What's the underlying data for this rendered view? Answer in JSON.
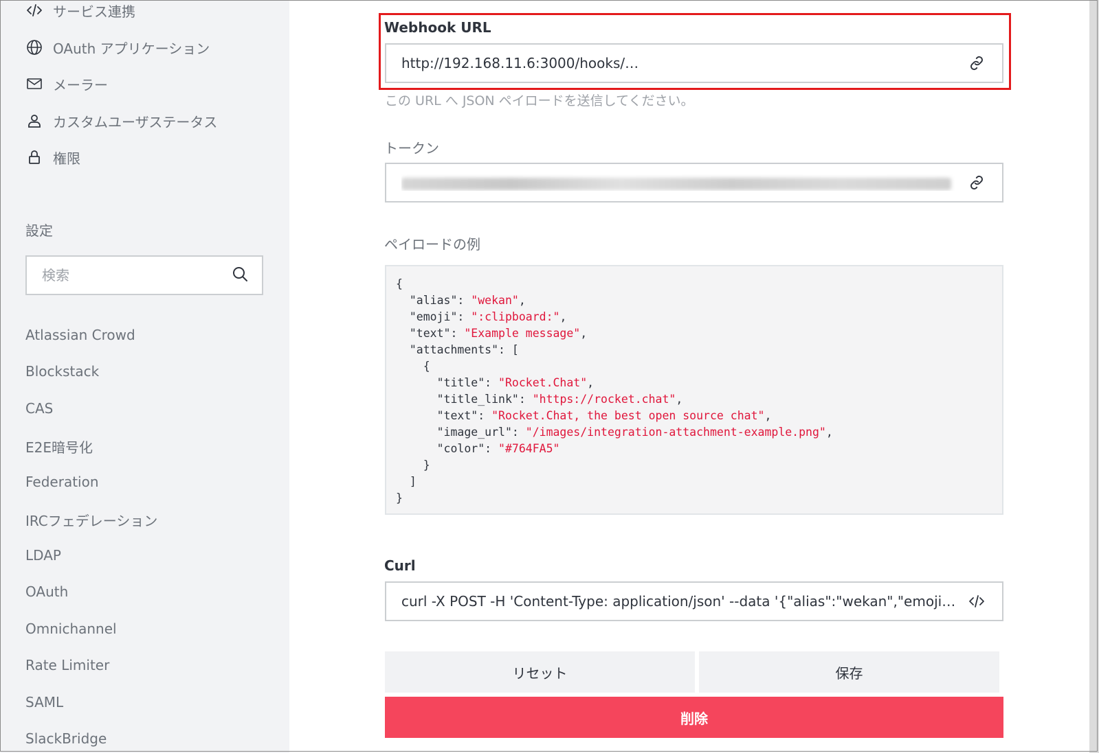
{
  "sidebar": {
    "nav_items": [
      {
        "label": "サービス連携",
        "icon": "code-icon"
      },
      {
        "label": "OAuth アプリケーション",
        "icon": "globe-icon"
      },
      {
        "label": "メーラー",
        "icon": "mail-icon"
      },
      {
        "label": "カスタムユーザステータス",
        "icon": "user-icon"
      },
      {
        "label": "権限",
        "icon": "lock-icon"
      }
    ],
    "settings_title": "設定",
    "search_placeholder": "検索",
    "settings_items": [
      "Atlassian Crowd",
      "Blockstack",
      "CAS",
      "E2E暗号化",
      "Federation",
      "IRCフェデレーション",
      "LDAP",
      "OAuth",
      "Omnichannel",
      "Rate Limiter",
      "SAML",
      "SlackBridge"
    ]
  },
  "main": {
    "webhook": {
      "label": "Webhook URL",
      "value_prefix": "http://192.168.11.6:3000/hooks/",
      "help": "この URL へ JSON ペイロードを送信してください。",
      "icon": "link-icon"
    },
    "token": {
      "label": "トークン",
      "icon": "link-icon"
    },
    "payload": {
      "label": "ペイロードの例"
    },
    "curl": {
      "label": "Curl",
      "value": "curl -X POST -H 'Content-Type: application/json' --data '{\"alias\":\"wekan\",\"emoji\":\":clipb...",
      "icon": "code-icon"
    },
    "buttons": {
      "reset": "リセット",
      "save": "保存",
      "delete": "削除"
    },
    "accent_colors": {
      "highlight": "#e31a1c",
      "danger": "#f5455c",
      "string": "#e0163b"
    }
  }
}
